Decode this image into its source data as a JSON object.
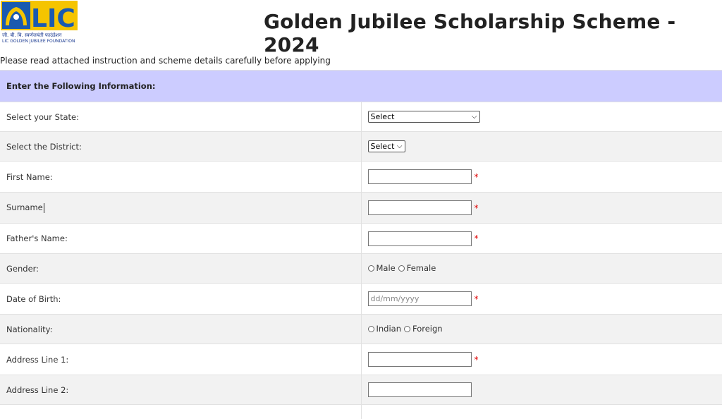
{
  "header": {
    "logo_text": "LIC",
    "logo_hindi": "जी. बी. बि. स्वर्णजयंती फाउंडेशन",
    "logo_foundation": "LIC GOLDEN JUBILEE FOUNDATION",
    "title": "Golden Jubilee Scholarship Scheme - 2024"
  },
  "instruction": "Please read attached instruction and scheme details carefully before applying",
  "form": {
    "heading": "Enter the Following Information:",
    "state": {
      "label": "Select your State:",
      "value": "Select"
    },
    "district": {
      "label": "Select the District:",
      "value": "Select"
    },
    "first_name": {
      "label": "First Name:",
      "value": ""
    },
    "surname": {
      "label": "Surname",
      "value": ""
    },
    "father_name": {
      "label": "Father's Name:",
      "value": ""
    },
    "gender": {
      "label": "Gender:",
      "options": [
        "Male",
        "Female"
      ]
    },
    "dob": {
      "label": "Date of Birth:",
      "placeholder": "dd/mm/yyyy"
    },
    "nationality": {
      "label": "Nationality:",
      "options": [
        "Indian",
        "Foreign"
      ]
    },
    "address1": {
      "label": "Address Line 1:",
      "value": ""
    },
    "address2": {
      "label": "Address Line 2:",
      "value": ""
    },
    "required_mark": "*"
  },
  "colors": {
    "header_row_bg": "#ccccff",
    "stripe_bg": "#f2f2f2",
    "required": "#e00000",
    "logo_blue": "#1a5ab0",
    "logo_yellow": "#f5c400"
  }
}
